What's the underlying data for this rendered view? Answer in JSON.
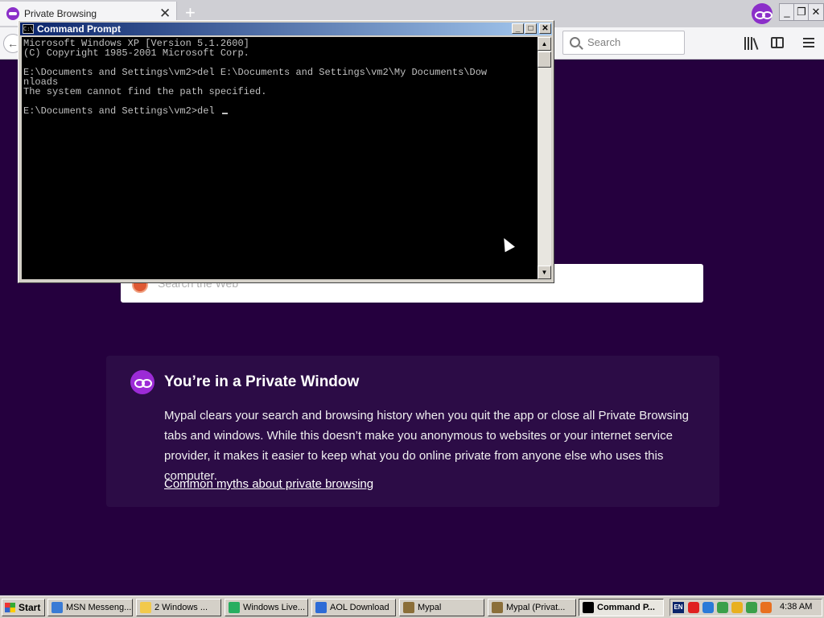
{
  "browser": {
    "tab": {
      "title": "Private Browsing",
      "close": "✕"
    },
    "new_tab": "+",
    "back": "←",
    "window_buttons": {
      "minimize": "_",
      "restore": "❐",
      "close": "✕"
    },
    "search": {
      "placeholder": "Search"
    }
  },
  "page": {
    "web_search": {
      "placeholder": "Search the Web"
    },
    "card": {
      "title": "You’re in a Private Window",
      "body": "Mypal clears your search and browsing history when you quit the app or close all Private Browsing tabs and windows. While this doesn’t make you anonymous to websites or your internet service provider, it makes it easier to keep what you do online private from anyone else who uses this computer.",
      "link": "Common myths about private browsing"
    }
  },
  "cmd": {
    "title": "Command Prompt",
    "icon_text": "C:\\",
    "buttons": {
      "minimize": "_",
      "maximize": "□",
      "close": "✕"
    },
    "lines": [
      "Microsoft Windows XP [Version 5.1.2600]",
      "(C) Copyright 1985-2001 Microsoft Corp.",
      "",
      "E:\\Documents and Settings\\vm2>del E:\\Documents and Settings\\vm2\\My Documents\\Dow",
      "nloads",
      "The system cannot find the path specified.",
      "",
      "E:\\Documents and Settings\\vm2>del "
    ]
  },
  "taskbar": {
    "start": "Start",
    "tasks": [
      {
        "label": "MSN Messeng...",
        "icon_color": "#3a7bd5",
        "active": false
      },
      {
        "label": "2 Windows ...",
        "icon_color": "#f2c94c",
        "active": false
      },
      {
        "label": "Windows Live...",
        "icon_color": "#27ae60",
        "active": false
      },
      {
        "label": "AOL Download",
        "icon_color": "#2d6bd6",
        "active": false
      },
      {
        "label": "Mypal",
        "icon_color": "#8b6f3a",
        "active": false
      },
      {
        "label": "Mypal (Privat...",
        "icon_color": "#8b6f3a",
        "active": false
      },
      {
        "label": "Command P...",
        "icon_color": "#000000",
        "active": true
      }
    ],
    "tray": {
      "language": "EN",
      "icons": [
        "#e02020",
        "#2a7ad8",
        "#3aa04a",
        "#e8b020",
        "#3aa04a",
        "#e87020"
      ],
      "clock": "4:38 AM"
    }
  }
}
